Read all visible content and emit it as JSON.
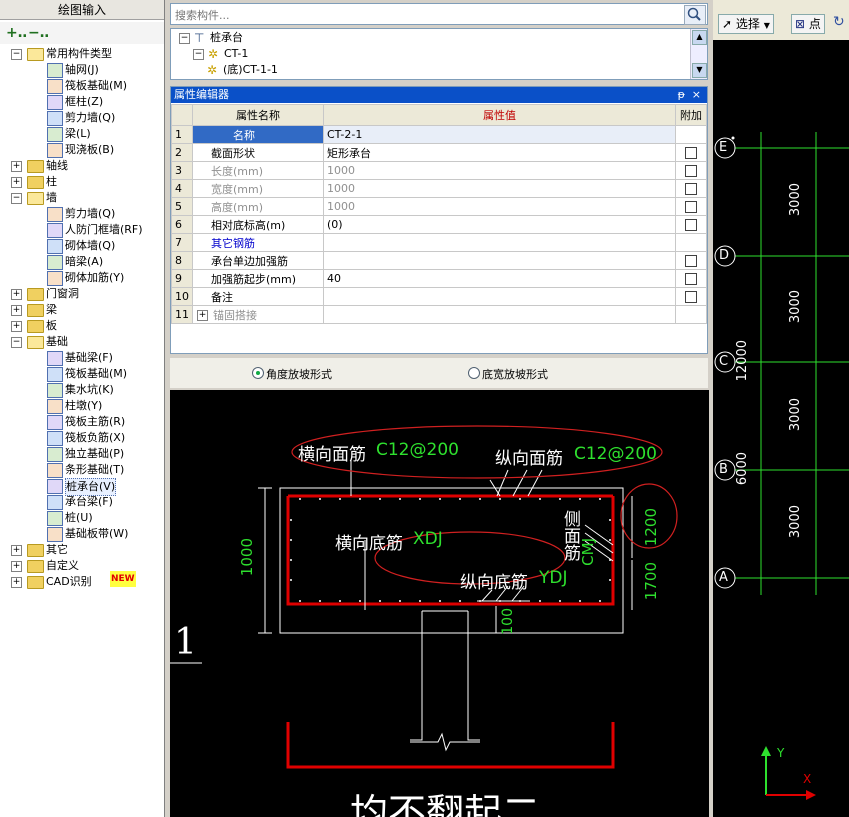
{
  "left_panel": {
    "title": "绘图输入",
    "tree": [
      {
        "label": "常用构件类型",
        "level": 0,
        "expanded": true,
        "folder": true
      },
      {
        "label": "轴网(J)",
        "level": 1
      },
      {
        "label": "筏板基础(M)",
        "level": 1
      },
      {
        "label": "框柱(Z)",
        "level": 1
      },
      {
        "label": "剪力墙(Q)",
        "level": 1
      },
      {
        "label": "梁(L)",
        "level": 1
      },
      {
        "label": "现浇板(B)",
        "level": 1
      },
      {
        "label": "轴线",
        "level": 0,
        "expanded": false,
        "folder": true
      },
      {
        "label": "柱",
        "level": 0,
        "expanded": false,
        "folder": true
      },
      {
        "label": "墙",
        "level": 0,
        "expanded": true,
        "folder": true
      },
      {
        "label": "剪力墙(Q)",
        "level": 1
      },
      {
        "label": "人防门框墙(RF)",
        "level": 1
      },
      {
        "label": "砌体墙(Q)",
        "level": 1
      },
      {
        "label": "暗梁(A)",
        "level": 1
      },
      {
        "label": "砌体加筋(Y)",
        "level": 1
      },
      {
        "label": "门窗洞",
        "level": 0,
        "expanded": false,
        "folder": true
      },
      {
        "label": "梁",
        "level": 0,
        "expanded": false,
        "folder": true
      },
      {
        "label": "板",
        "level": 0,
        "expanded": false,
        "folder": true
      },
      {
        "label": "基础",
        "level": 0,
        "expanded": true,
        "folder": true
      },
      {
        "label": "基础梁(F)",
        "level": 1
      },
      {
        "label": "筏板基础(M)",
        "level": 1
      },
      {
        "label": "集水坑(K)",
        "level": 1
      },
      {
        "label": "柱墩(Y)",
        "level": 1
      },
      {
        "label": "筏板主筋(R)",
        "level": 1
      },
      {
        "label": "筏板负筋(X)",
        "level": 1
      },
      {
        "label": "独立基础(P)",
        "level": 1
      },
      {
        "label": "条形基础(T)",
        "level": 1
      },
      {
        "label": "桩承台(V)",
        "level": 1,
        "selected": true
      },
      {
        "label": "承台梁(F)",
        "level": 1
      },
      {
        "label": "桩(U)",
        "level": 1
      },
      {
        "label": "基础板带(W)",
        "level": 1
      },
      {
        "label": "其它",
        "level": 0,
        "expanded": false,
        "folder": true
      },
      {
        "label": "自定义",
        "level": 0,
        "expanded": false,
        "folder": true
      },
      {
        "label": "CAD识别",
        "level": 0,
        "expanded": false,
        "folder": true,
        "badge": "NEW"
      }
    ]
  },
  "search": {
    "placeholder": "搜索构件..."
  },
  "component_tree": [
    {
      "label": "桩承台",
      "level": 0
    },
    {
      "label": "CT-1",
      "level": 1
    },
    {
      "label": "(底)CT-1-1",
      "level": 2
    }
  ],
  "property_editor": {
    "title": "属性编辑器",
    "pin": "ᵽ",
    "close": "×",
    "headers": {
      "name": "属性名称",
      "value": "属性值",
      "extra": "附加"
    },
    "rows": [
      {
        "no": "1",
        "name": "名称",
        "value": "CT-2-1",
        "check": false,
        "style": "selected"
      },
      {
        "no": "2",
        "name": "截面形状",
        "value": "矩形承台",
        "check": true,
        "style": "normal"
      },
      {
        "no": "3",
        "name": "长度(mm)",
        "value": "1000",
        "check": true,
        "style": "gray"
      },
      {
        "no": "4",
        "name": "宽度(mm)",
        "value": "1000",
        "check": true,
        "style": "gray"
      },
      {
        "no": "5",
        "name": "高度(mm)",
        "value": "1000",
        "check": true,
        "style": "gray"
      },
      {
        "no": "6",
        "name": "相对底标高(m)",
        "value": "(0)",
        "check": true,
        "style": "normal"
      },
      {
        "no": "7",
        "name": "其它钢筋",
        "value": "",
        "check": false,
        "style": "blue"
      },
      {
        "no": "8",
        "name": "承台单边加强筋",
        "value": "",
        "check": true,
        "style": "normal"
      },
      {
        "no": "9",
        "name": "加强筋起步(mm)",
        "value": "40",
        "check": true,
        "style": "normal"
      },
      {
        "no": "10",
        "name": "备注",
        "value": "",
        "check": true,
        "style": "normal"
      },
      {
        "no": "11",
        "name": "锚固搭接",
        "value": "",
        "check": false,
        "style": "expand"
      }
    ]
  },
  "slope_options": [
    {
      "label": "角度放坡形式",
      "selected": true
    },
    {
      "label": "底宽放坡形式",
      "selected": false
    }
  ],
  "drawing": {
    "top_transverse": "横向面筋",
    "top_transverse_spec": "C12@200",
    "top_longitudinal": "纵向面筋",
    "top_longitudinal_spec": "C12@200",
    "bottom_transverse": "横向底筋",
    "bottom_transverse_spec": "XDJ",
    "bottom_longitudinal": "纵向底筋",
    "bottom_longitudinal_spec": "YDJ",
    "side_rebar": "侧面筋",
    "side_rebar_spec": "CMJ",
    "dim_height": "1000",
    "dim_1200": "1200",
    "dim_1700": "1700",
    "dim_100": "100",
    "section_mark": "1",
    "bottom_text": "均不翻起二"
  },
  "right_panel": {
    "select_button": "选择",
    "point_button": "点",
    "axis_labels": [
      "E",
      "D",
      "C",
      "B",
      "A"
    ],
    "dims_inner": [
      "3000",
      "3000",
      "3000",
      "3000"
    ],
    "dim_total": "12000",
    "dim_partial": "6000",
    "axis_y": "Y",
    "axis_x": "X"
  },
  "colors": {
    "title_blue": "#0a50c8",
    "rebar_red": "#e00000",
    "spec_green": "#2ee02e",
    "ellipse_red": "#d02020"
  }
}
